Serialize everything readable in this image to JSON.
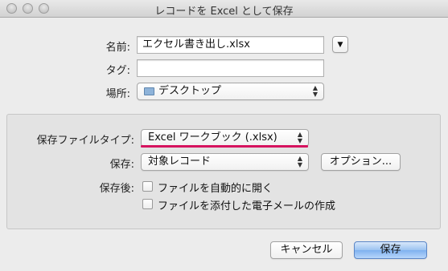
{
  "window": {
    "title": "レコードを Excel として保存"
  },
  "colors": {
    "accent_underline": "#d6135f",
    "primary_button": "#8fbcf0"
  },
  "save": {
    "name_label": "名前:",
    "name_value": "エクセル書き出し.xlsx",
    "expand_icon": "chevron-down-icon",
    "tags_label": "タグ:",
    "tags_value": "",
    "where_label": "場所:",
    "where_value": "デスクトップ",
    "where_icon": "folder-icon"
  },
  "options": {
    "file_type_label": "保存ファイルタイプ:",
    "file_type_value": "Excel ワークブック (.xlsx)",
    "save_label": "保存:",
    "save_value": "対象レコード",
    "options_button": "オプション...",
    "after_save_label": "保存後:",
    "checkbox_open": "ファイルを自動的に開く",
    "checkbox_email": "ファイルを添付した電子メールの作成"
  },
  "footer": {
    "cancel": "キャンセル",
    "save": "保存"
  }
}
